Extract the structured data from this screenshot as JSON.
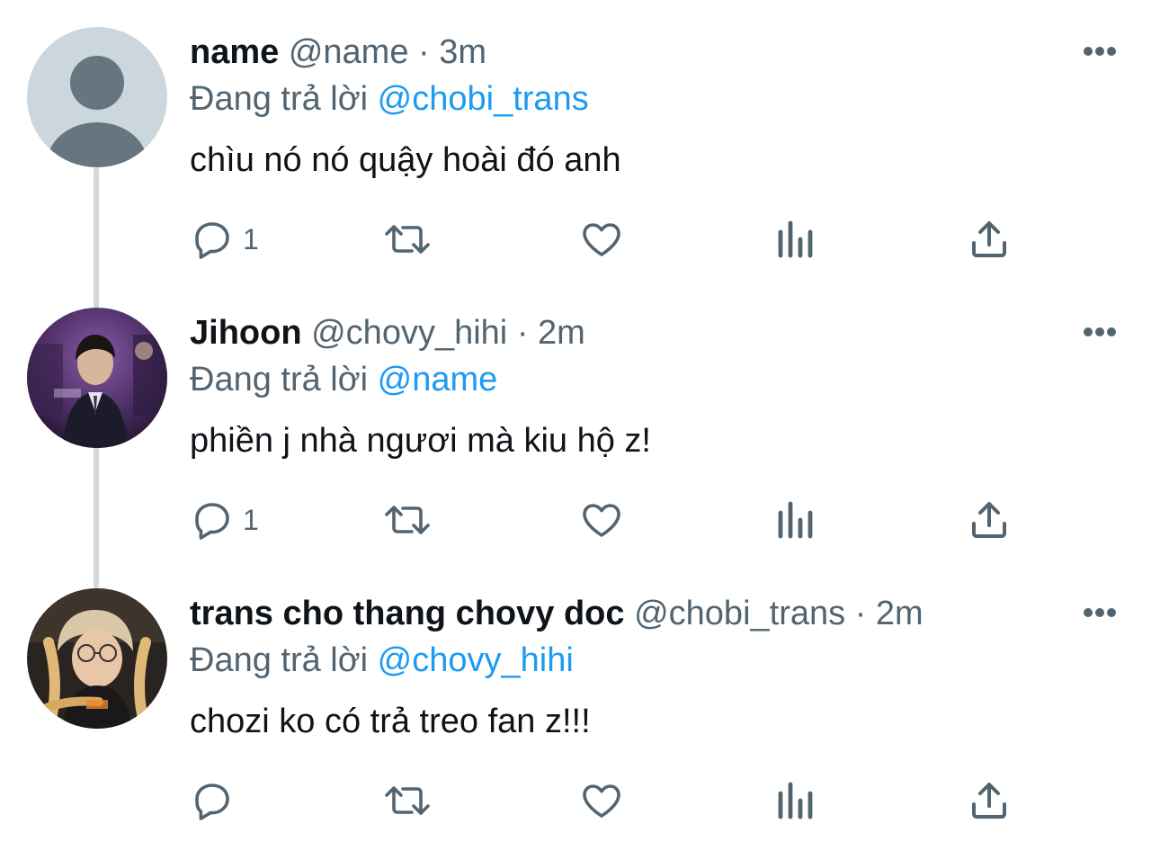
{
  "tweets": [
    {
      "display_name": "name",
      "handle": "@name",
      "separator": "·",
      "time": "3m",
      "reply_prefix": "Đang trả lời",
      "reply_to": "@chobi_trans",
      "text": "chìu nó nó quậy hoài đó anh",
      "reply_count": "1",
      "avatar": "default-avatar"
    },
    {
      "display_name": "Jihoon",
      "handle": "@chovy_hihi",
      "separator": "·",
      "time": "2m",
      "reply_prefix": "Đang trả lời",
      "reply_to": "@name",
      "text": "phiền j nhà ngươi mà kiu hộ z!",
      "reply_count": "1",
      "avatar": "photo-avatar"
    },
    {
      "display_name": "trans cho thang chovy doc",
      "handle": "@chobi_trans",
      "separator": "·",
      "time": "2m",
      "reply_prefix": "Đang trả lời",
      "reply_to": "@chovy_hihi",
      "text": "chozi ko có trả treo fan z!!!",
      "reply_count": "",
      "avatar": "photo-avatar"
    }
  ],
  "icons": {
    "reply": "reply-icon",
    "retweet": "retweet-icon",
    "like": "heart-icon",
    "analytics": "analytics-icon",
    "share": "share-icon",
    "more": "more-icon"
  },
  "colors": {
    "text": "#0f1419",
    "secondary": "#536471",
    "link": "#1d9bf0",
    "thread_line": "#cfd9de"
  }
}
